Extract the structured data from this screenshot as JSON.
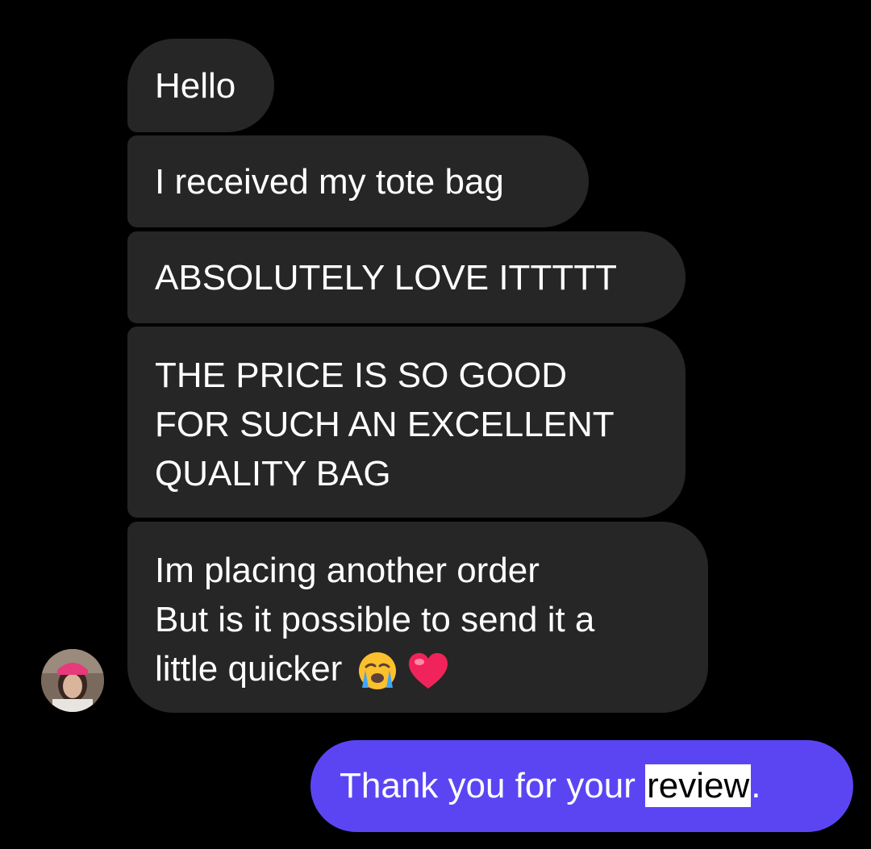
{
  "conversation": {
    "received": [
      {
        "lines": [
          "Hello"
        ]
      },
      {
        "lines": [
          "I received my tote bag"
        ]
      },
      {
        "lines": [
          "ABSOLUTELY LOVE ITTTTT"
        ]
      },
      {
        "lines": [
          "THE PRICE IS SO GOOD",
          "FOR SUCH AN EXCELLENT",
          "QUALITY BAG"
        ]
      },
      {
        "lines": [
          "Im placing another order",
          "But is it possible to send it a",
          "little quicker"
        ],
        "emojis": [
          "crying-face-emoji",
          "heart-emoji"
        ]
      }
    ],
    "sent": {
      "before": "Thank you for your ",
      "highlighted": "review",
      "after": "."
    }
  },
  "colors": {
    "background": "#000000",
    "received_bubble": "#262626",
    "sent_bubble": "#5b45f3",
    "text": "#ffffff",
    "selection_highlight": "#ffffff"
  },
  "icons": {
    "avatar": "sender-avatar"
  }
}
